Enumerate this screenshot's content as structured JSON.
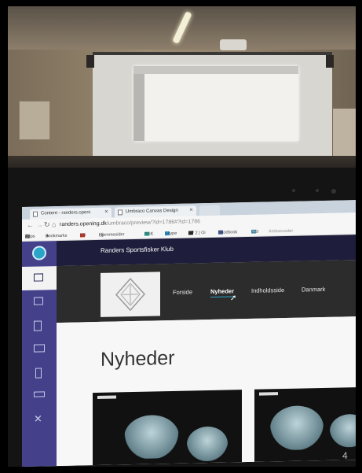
{
  "browser": {
    "tabs": [
      {
        "label": "Content - randers.openi"
      },
      {
        "label": "Umbraco Canvas Design"
      }
    ],
    "url_host": "randers.opening.dk",
    "url_path": "/umbraco/preview/?id=1786#?id=1786",
    "bookmarks": [
      "Apps",
      "Bookmarks",
      "EB",
      "Hjemmesider",
      "RSK",
      "Skype",
      "TV 2 | Oi",
      "Facebook",
      "CSI",
      "Ambassadør"
    ]
  },
  "site": {
    "name": "Randers Sportsfisker Klub",
    "menu": [
      "Forside",
      "Nyheder",
      "Indholdsside",
      "Danmark"
    ],
    "active_menu": "Nyheder",
    "heading": "Nyheder"
  },
  "overlay": {
    "corner_number": "4"
  },
  "colors": {
    "sidebar": "#44418a",
    "topbar": "#1e1d3b",
    "hero": "#2c2c2c",
    "accent": "#2aa4c9"
  },
  "icons": [
    "umbraco-logo-icon",
    "content-icon",
    "media-icon",
    "settings-icon",
    "developer-icon",
    "users-icon",
    "members-icon",
    "translation-icon",
    "close-icon"
  ]
}
